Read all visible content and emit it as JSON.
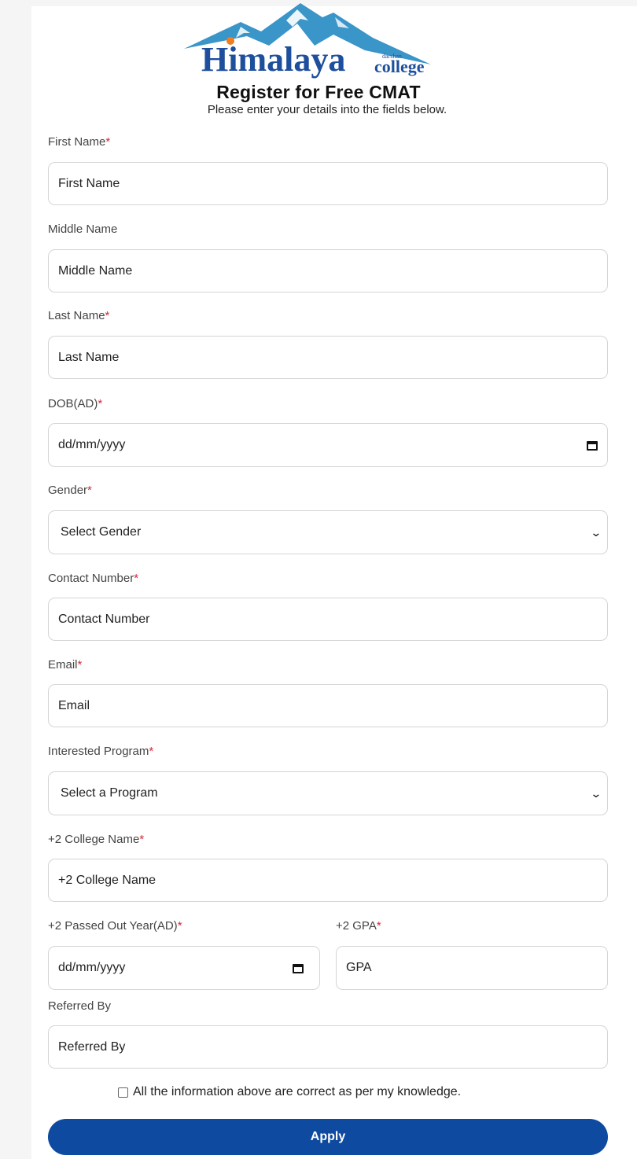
{
  "brand": {
    "logo_main": "Himalaya",
    "logo_small_top": "darshan",
    "logo_small_bottom": "college",
    "colors": {
      "primary": "#0d4aa0",
      "required": "#d9263a",
      "mountain": "#3a95c8"
    }
  },
  "header": {
    "title": "Register for Free CMAT",
    "subtitle": "Please enter your details into the fields below."
  },
  "form": {
    "first_name": {
      "label": "First Name",
      "required": "*",
      "placeholder": "First Name"
    },
    "middle_name": {
      "label": "Middle Name",
      "placeholder": "Middle Name"
    },
    "last_name": {
      "label": "Last Name",
      "required": "*",
      "placeholder": "Last Name"
    },
    "dob": {
      "label": "DOB(AD)",
      "required": "*",
      "placeholder": "dd/mm/yyyy",
      "icon": "calendar-icon"
    },
    "gender": {
      "label": "Gender",
      "required": "*",
      "selected": "Select Gender",
      "icon": "chevron-down-icon"
    },
    "contact": {
      "label": "Contact Number",
      "required": "*",
      "placeholder": "Contact Number"
    },
    "email": {
      "label": "Email",
      "required": "*",
      "placeholder": "Email"
    },
    "program": {
      "label": "Interested Program",
      "required": "*",
      "selected": "Select a Program",
      "icon": "chevron-down-icon"
    },
    "college": {
      "label": "+2 College Name",
      "required": "*",
      "placeholder": "+2 College Name"
    },
    "passed_year": {
      "label": "+2 Passed Out Year(AD)",
      "required": "*",
      "placeholder": "dd/mm/yyyy",
      "icon": "calendar-icon"
    },
    "gpa": {
      "label": "+2 GPA",
      "required": "*",
      "placeholder": "GPA"
    },
    "referred_by": {
      "label": "Referred By",
      "placeholder": "Referred By"
    },
    "agreement": "All the information above are correct as per my knowledge.",
    "submit_label": "Apply"
  }
}
